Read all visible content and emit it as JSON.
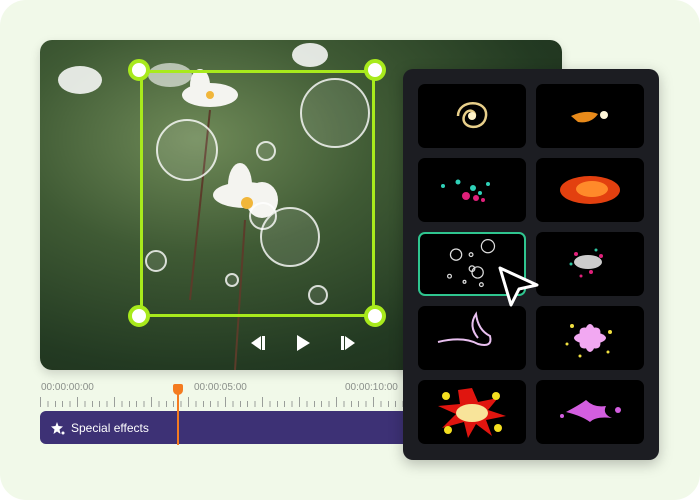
{
  "player": {
    "controls": [
      {
        "name": "previous-frame",
        "icon": "step-back-icon"
      },
      {
        "name": "play",
        "icon": "play-icon"
      },
      {
        "name": "next-frame",
        "icon": "step-forward-icon"
      }
    ],
    "selection_color": "#a8ea1c"
  },
  "timeline": {
    "labels": [
      "00:00:00:00",
      "00:00:05:00",
      "00:00:10:00"
    ],
    "playhead_color": "#f47b20",
    "track": {
      "label": "Special effects",
      "icon": "sparkle-icon",
      "color": "#3d3175"
    }
  },
  "effects_panel": {
    "selected_index": 4,
    "selected_color": "#2fc58f",
    "items": [
      {
        "name": "golden-swirl"
      },
      {
        "name": "fire-spark"
      },
      {
        "name": "teal-pink-particles"
      },
      {
        "name": "fire-explosion"
      },
      {
        "name": "bubbles"
      },
      {
        "name": "glitter-burst"
      },
      {
        "name": "light-trail"
      },
      {
        "name": "pink-flower"
      },
      {
        "name": "comic-explosion"
      },
      {
        "name": "purple-splash"
      }
    ]
  }
}
